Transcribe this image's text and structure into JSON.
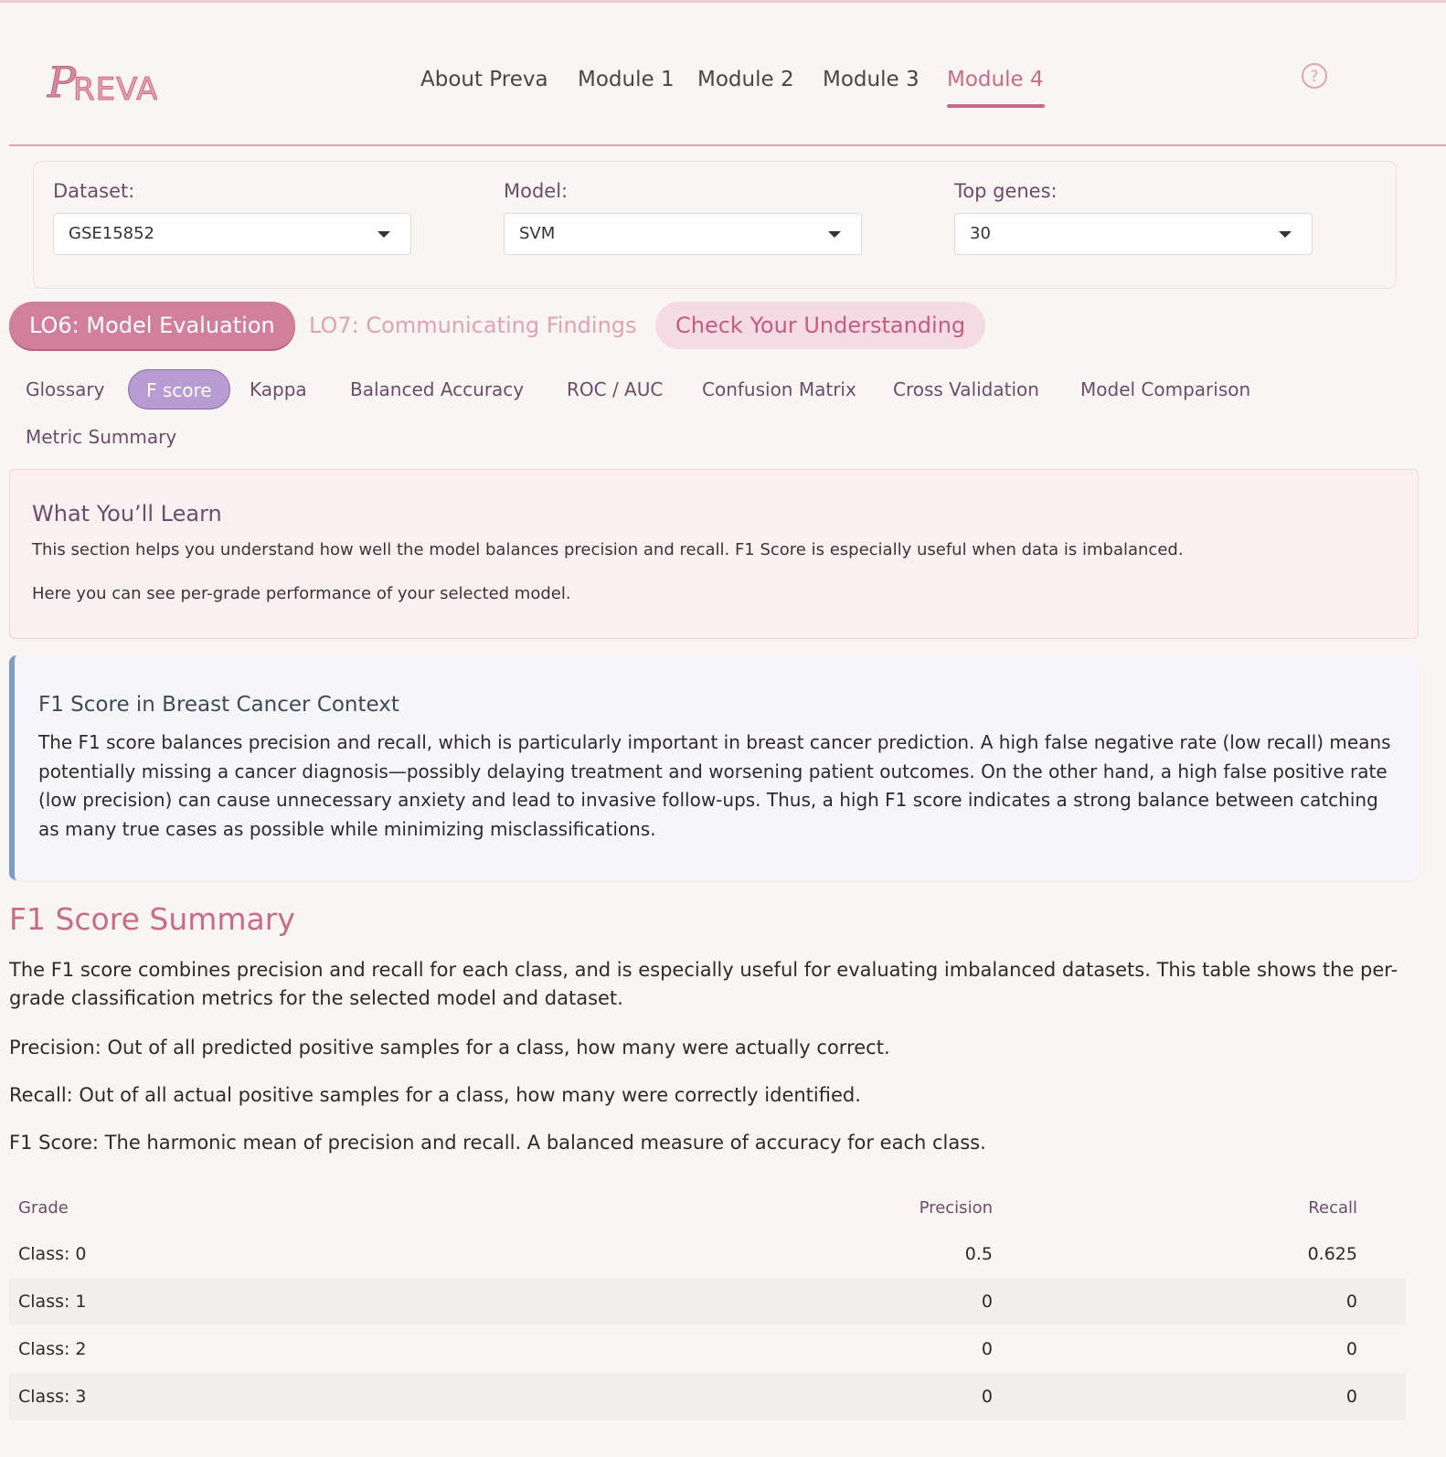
{
  "nav": {
    "logo_text": "PREVA",
    "items": [
      "About Preva",
      "Module 1",
      "Module 2",
      "Module 3",
      "Module 4"
    ],
    "active": "Module 4",
    "help_icon": "question-circle-icon"
  },
  "filters": {
    "dataset_label": "Dataset:",
    "dataset_value": "GSE15852",
    "model_label": "Model:",
    "model_value": "SVM",
    "genes_label": "Top genes:",
    "genes_value": "30"
  },
  "lo_tabs": [
    "LO6: Model Evaluation",
    "LO7: Communicating Findings",
    "Check Your Understanding"
  ],
  "sub_tabs": [
    "Glossary",
    "F score",
    "Kappa",
    "Balanced Accuracy",
    "ROC / AUC",
    "Confusion Matrix",
    "Cross Validation",
    "Model Comparison",
    "Metric Summary"
  ],
  "learn": {
    "title": "What You’ll Learn",
    "p1": "This section helps you understand how well the model balances precision and recall. F1 Score is especially useful when data is imbalanced.",
    "p2": "Here you can see per-grade performance of your selected model."
  },
  "context": {
    "title": "F1 Score in Breast Cancer Context",
    "text": "The F1 score balances precision and recall, which is particularly important in breast cancer prediction. A high false negative rate (low recall) means potentially missing a cancer diagnosis—possibly delaying treatment and worsening patient outcomes. On the other hand, a high false positive rate (low precision) can cause unnecessary anxiety and lead to invasive follow-ups. Thus, a high F1 score indicates a strong balance between catching as many true cases as possible while minimizing misclassifications."
  },
  "summary": {
    "title": "F1 Score Summary",
    "intro": "The F1 score combines precision and recall for each class, and is especially useful for evaluating imbalanced datasets. This table shows the per-grade classification metrics for the selected model and dataset.",
    "precision_def": "Precision: Out of all predicted positive samples for a class, how many were actually correct.",
    "recall_def": "Recall: Out of all actual positive samples for a class, how many were correctly identified.",
    "f1_def": "F1 Score: The harmonic mean of precision and recall. A balanced measure of accuracy for each class."
  },
  "table": {
    "headers": [
      "Grade",
      "Precision",
      "Recall"
    ],
    "rows": [
      [
        "Class: 0",
        "0.5",
        "0.625"
      ],
      [
        "Class: 1",
        "0",
        "0"
      ],
      [
        "Class: 2",
        "0",
        "0"
      ],
      [
        "Class: 3",
        "0",
        "0"
      ]
    ]
  }
}
